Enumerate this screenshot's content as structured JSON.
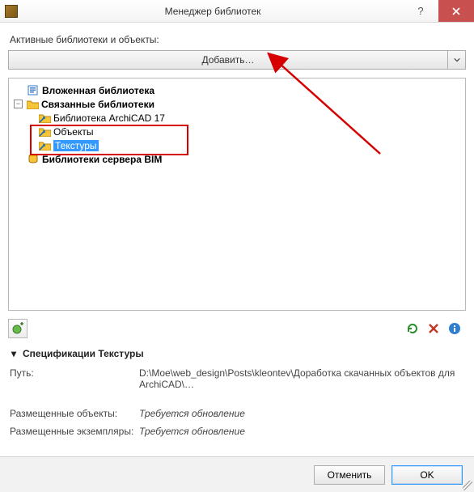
{
  "window": {
    "title": "Менеджер библиотек"
  },
  "labels": {
    "active_libs": "Активные библиотеки и объекты:",
    "add_button": "Добавить…",
    "spec_header": "Спецификации Текстуры",
    "path_label": "Путь:",
    "path_value": "D:\\Moe\\web_design\\Posts\\kleontev\\Доработка скачанных объектов для ArchiCAD\\…",
    "placed_objects_label": "Размещенные объекты:",
    "placed_objects_value": "Требуется обновление",
    "placed_instances_label": "Размещенные экземпляры:",
    "placed_instances_value": "Требуется обновление",
    "cancel": "Отменить",
    "ok": "OK"
  },
  "tree": {
    "n0": {
      "label": "Вложенная библиотека"
    },
    "n1": {
      "label": "Связанные библиотеки"
    },
    "n1a": {
      "label": "Библиотека ArchiCAD 17"
    },
    "n1b": {
      "label": "Объекты"
    },
    "n1c": {
      "label": "Текстуры"
    },
    "n2": {
      "label": "Библиотеки сервера BIM"
    }
  }
}
